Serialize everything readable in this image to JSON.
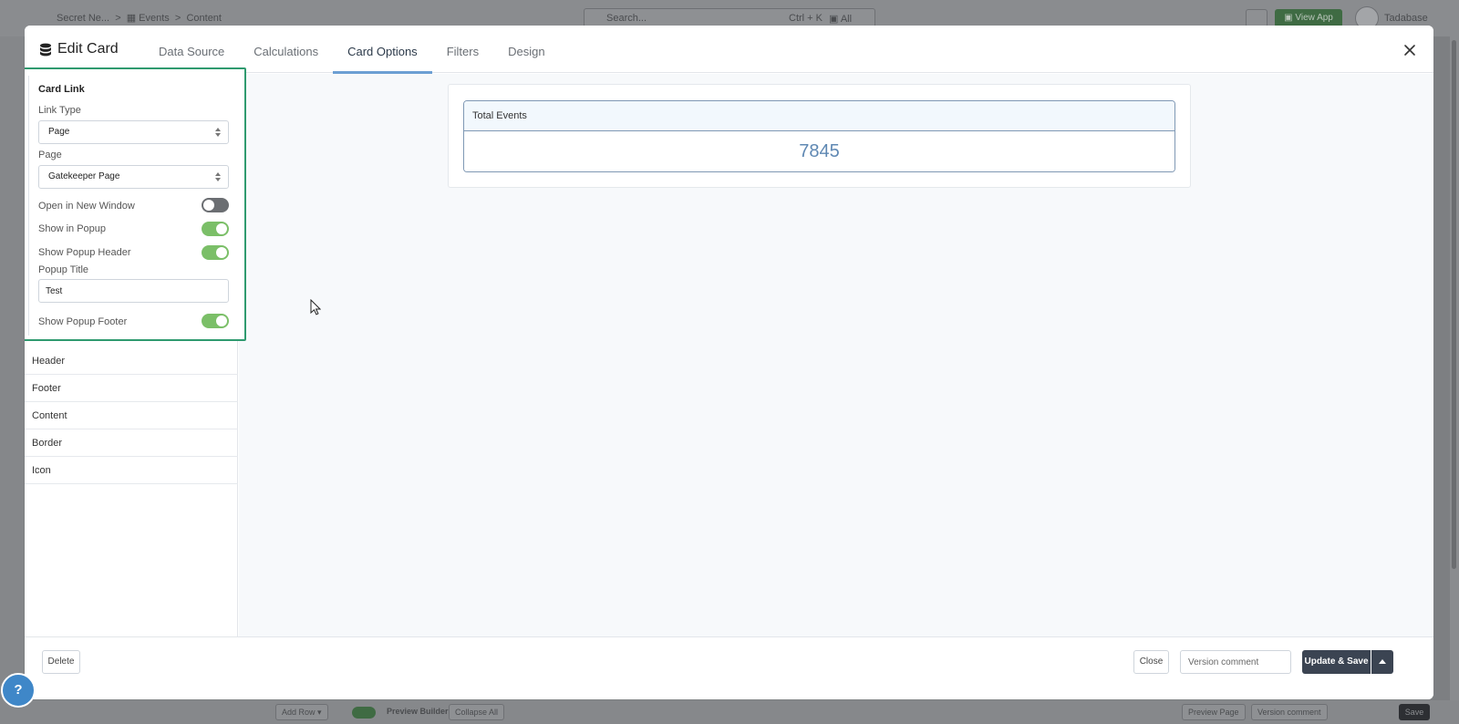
{
  "modal": {
    "title": "Edit Card",
    "tabs": [
      {
        "label": "Data Source"
      },
      {
        "label": "Calculations"
      },
      {
        "label": "Card Options"
      },
      {
        "label": "Filters"
      },
      {
        "label": "Design"
      }
    ],
    "active_tab": "Card Options"
  },
  "card_link": {
    "section_title": "Card Link",
    "link_type_label": "Link Type",
    "link_type_value": "Page",
    "page_label": "Page",
    "page_value": "Gatekeeper Page",
    "open_new_window_label": "Open in New Window",
    "open_new_window": false,
    "show_in_popup_label": "Show in Popup",
    "show_in_popup": true,
    "show_popup_header_label": "Show Popup Header",
    "show_popup_header": true,
    "popup_title_label": "Popup Title",
    "popup_title_value": "Test",
    "show_popup_footer_label": "Show Popup Footer",
    "show_popup_footer": true
  },
  "options": [
    {
      "label": "Header"
    },
    {
      "label": "Footer"
    },
    {
      "label": "Content"
    },
    {
      "label": "Border"
    },
    {
      "label": "Icon"
    }
  ],
  "preview": {
    "card_title": "Total Events",
    "card_value": "7845"
  },
  "footer": {
    "delete_label": "Delete",
    "close_label": "Close",
    "version_placeholder": "Version comment",
    "save_label": "Update & Save"
  },
  "help": {
    "label": "?"
  },
  "colors": {
    "accent": "#6c9fd3",
    "toggle_on": "#7bbf68",
    "highlight_border": "#2f9a6f",
    "primary_button": "#3b4452"
  }
}
